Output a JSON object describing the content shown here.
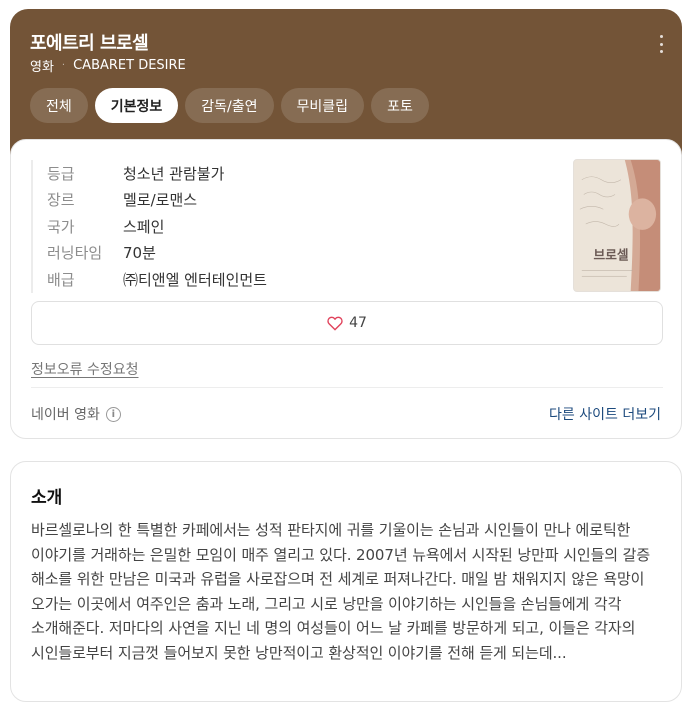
{
  "header": {
    "title": "포에트리 브로셀",
    "category": "영화",
    "separator": "·",
    "original_title": "CABARET DESIRE",
    "more_icon": "more-vertical-icon",
    "background_color": "#735437"
  },
  "tabs": [
    {
      "label": "전체",
      "active": false
    },
    {
      "label": "기본정보",
      "active": true
    },
    {
      "label": "감독/출연",
      "active": false
    },
    {
      "label": "무비클립",
      "active": false
    },
    {
      "label": "포토",
      "active": false
    }
  ],
  "info": {
    "rows": [
      {
        "label": "등급",
        "value": "청소년 관람불가"
      },
      {
        "label": "장르",
        "value": "멜로/로맨스"
      },
      {
        "label": "국가",
        "value": "스페인"
      },
      {
        "label": "러닝타임",
        "value": "70분"
      },
      {
        "label": "배급",
        "value": "㈜티앤엘 엔터테인먼트"
      }
    ],
    "poster_text": "브로셀",
    "like_icon": "heart-outline-icon",
    "like_count": "47",
    "report_link": "정보오류 수정요청",
    "source": "네이버 영화",
    "source_icon": "info-circle-icon",
    "other_sites_link": "다른 사이트 더보기",
    "link_color": "#1c4a7d",
    "heart_color": "#e0425b"
  },
  "intro": {
    "title": "소개",
    "text": "바르셀로나의 한 특별한 카페에서는 성적 판타지에 귀를 기울이는 손님과 시인들이 만나 에로틱한 이야기를 거래하는 은밀한 모임이 매주 열리고 있다. 2007년 뉴욕에서 시작된 낭만파 시인들의 갈증 해소를 위한 만남은 미국과 유럽을 사로잡으며 전 세계로 퍼져나간다. 매일 밤 채워지지 않은 욕망이 오가는 이곳에서 여주인은 춤과 노래, 그리고 시로 낭만을 이야기하는 시인들을 손님들에게 각각 소개해준다. 저마다의 사연을 지닌 네 명의 여성들이 어느 날 카페를 방문하게 되고, 이들은 각자의 시인들로부터 지금껏 들어보지 못한 낭만적이고 환상적인 이야기를 전해 듣게 되는데..."
  }
}
